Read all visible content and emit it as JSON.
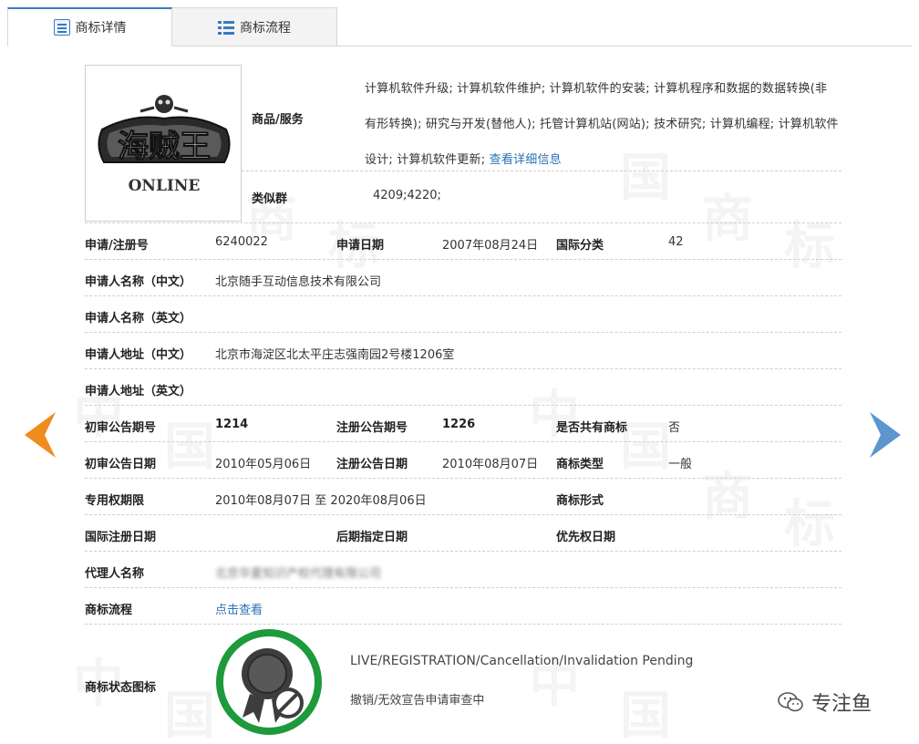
{
  "tabs": [
    {
      "label": "商标详情",
      "icon": "document-icon",
      "active": true
    },
    {
      "label": "商标流程",
      "icon": "list-icon",
      "active": false
    }
  ],
  "logo": {
    "text_main": "海贼王",
    "text_sub": "ONLINE"
  },
  "goods_services": {
    "label": "商品/服务",
    "text": "计算机软件升级; 计算机软件维护; 计算机软件的安装; 计算机程序和数据的数据转换(非有形转换); 研究与开发(替他人); 托管计算机站(网站); 技术研究; 计算机编程; 计算机软件设计; 计算机软件更新;",
    "link": "查看详细信息"
  },
  "similar_group": {
    "label": "类似群",
    "value": "4209;4220;"
  },
  "fields": {
    "reg_no_label": "申请/注册号",
    "reg_no": "6240022",
    "apply_date_label": "申请日期",
    "apply_date": "2007年08月24日",
    "intl_class_label": "国际分类",
    "intl_class": "42",
    "applicant_cn_label": "申请人名称（中文）",
    "applicant_cn": "北京随手互动信息技术有限公司",
    "applicant_en_label": "申请人名称（英文）",
    "address_cn_label": "申请人地址（中文）",
    "address_cn": "北京市海淀区北太平庄志强南园2号楼1206室",
    "address_en_label": "申请人地址（英文）",
    "prelim_no_label": "初审公告期号",
    "prelim_no": "1214",
    "reg_pub_no_label": "注册公告期号",
    "reg_pub_no": "1226",
    "shared_label": "是否共有商标",
    "shared": "否",
    "prelim_date_label": "初审公告日期",
    "prelim_date": "2010年05月06日",
    "reg_pub_date_label": "注册公告日期",
    "reg_pub_date": "2010年08月07日",
    "tm_type_label": "商标类型",
    "tm_type": "一般",
    "exclusive_label": "专用权期限",
    "exclusive": "2010年08月07日 至 2020年08月06日",
    "tm_form_label": "商标形式",
    "intl_reg_date_label": "国际注册日期",
    "later_designation_label": "后期指定日期",
    "priority_date_label": "优先权日期",
    "agent_label": "代理人名称",
    "agent": "北京华夏知识产权代理有限公司",
    "process_label": "商标流程",
    "process_link": "点击查看"
  },
  "status": {
    "label": "商标状态图标",
    "en": "LIVE/REGISTRATION/Cancellation/Invalidation Pending",
    "cn": "撤销/无效宣告申请审查中",
    "ring_color": "#1e9a3c"
  },
  "watermark": {
    "account": "专注鱼"
  },
  "colors": {
    "accent": "#3a79c4",
    "link": "#2a72b5",
    "arrow_left": "#f08c1e",
    "arrow_right": "#5d95cf"
  }
}
